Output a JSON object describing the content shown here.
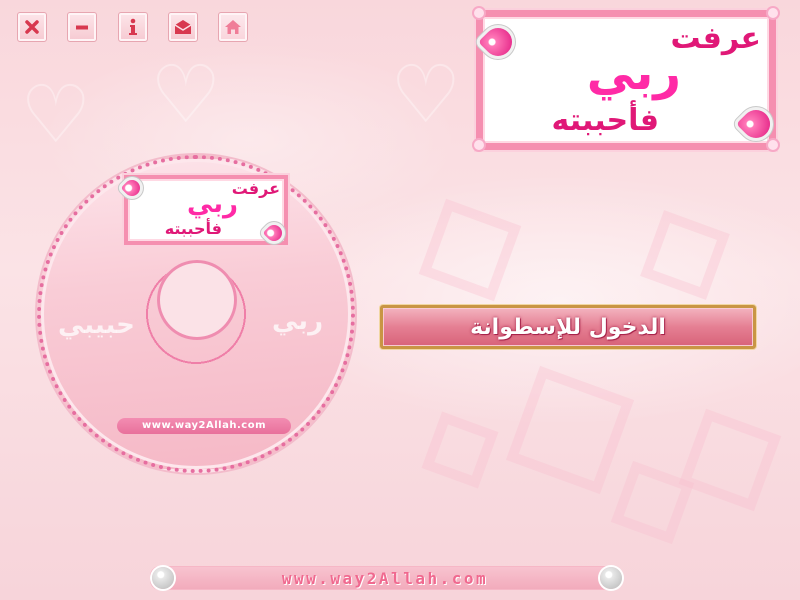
{
  "toolbar": {
    "buttons": [
      {
        "icon": "close-icon"
      },
      {
        "icon": "minimize-icon"
      },
      {
        "icon": "info-icon"
      },
      {
        "icon": "mail-icon"
      },
      {
        "icon": "home-icon"
      }
    ]
  },
  "logo": {
    "line1": "عرفت",
    "line2": "ربي",
    "line3": "فأحببته"
  },
  "disc": {
    "logo": {
      "line1": "عرفت",
      "line2": "ربي",
      "line3": "فأحببته"
    },
    "word_left": "حبيبي",
    "word_right": "ربي",
    "url": "www.way2Allah.com"
  },
  "enter_button": {
    "label": "الدخول للإسطوانة"
  },
  "footer": {
    "url": "www.way2Allah.com"
  },
  "colors": {
    "accent": "#e0157e",
    "button_gold": "#c99544",
    "pink_text": "#f0698f"
  }
}
